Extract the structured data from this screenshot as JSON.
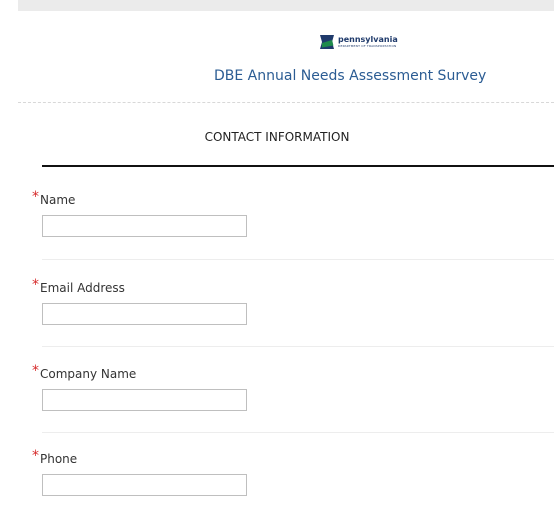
{
  "header": {
    "logo_name": "pennsylvania",
    "logo_subtitle": "DEPARTMENT OF TRANSPORTATION",
    "survey_title": "DBE Annual Needs Assessment Survey"
  },
  "section": {
    "title": "CONTACT INFORMATION"
  },
  "fields": [
    {
      "required_mark": "*",
      "label": "Name",
      "value": ""
    },
    {
      "required_mark": "*",
      "label": "Email Address",
      "value": ""
    },
    {
      "required_mark": "*",
      "label": "Company Name",
      "value": ""
    },
    {
      "required_mark": "*",
      "label": "Phone",
      "value": ""
    }
  ],
  "colors": {
    "title_blue": "#2b5c93",
    "required_red": "#d62a2a",
    "logo_navy": "#1f3a6b",
    "logo_green": "#1f8a4c"
  }
}
